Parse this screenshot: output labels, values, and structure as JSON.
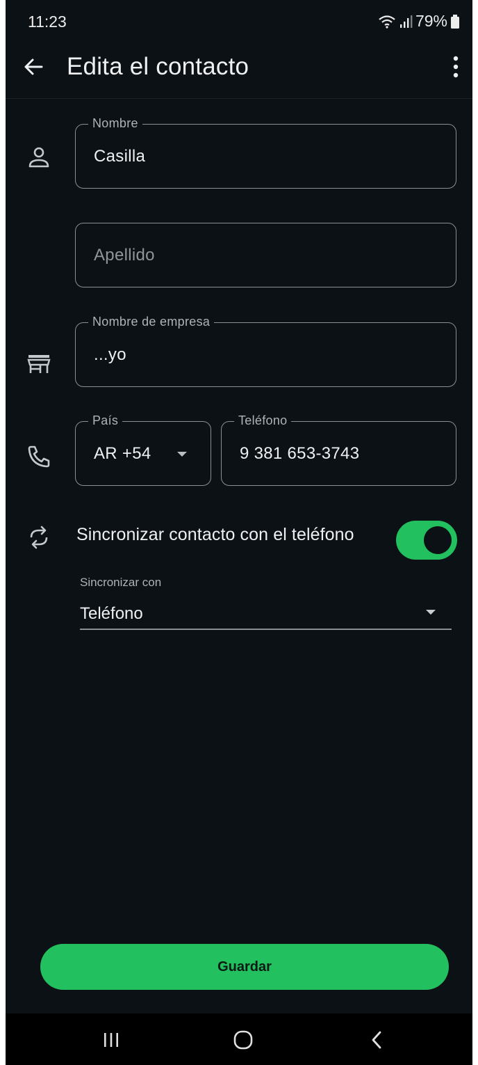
{
  "status_bar": {
    "time": "11:23",
    "battery": "79%"
  },
  "app_bar": {
    "title": "Edita el contacto"
  },
  "form": {
    "first_name": {
      "label": "Nombre",
      "value": "Casilla"
    },
    "last_name": {
      "placeholder": "Apellido"
    },
    "company": {
      "label": "Nombre de empresa",
      "value": "...yo"
    },
    "country": {
      "label": "País",
      "value": "AR +54"
    },
    "phone": {
      "label": "Teléfono",
      "value": "9 381 653-3743"
    },
    "sync": {
      "label": "Sincronizar contacto con el teléfono",
      "enabled": true
    },
    "sync_with": {
      "label": "Sincronizar con",
      "value": "Teléfono"
    }
  },
  "save_button": {
    "label": "Guardar"
  },
  "icons": {
    "back": "arrow-back-icon",
    "more": "more-vert-icon",
    "person": "person-icon",
    "store": "store-icon",
    "phone": "phone-icon",
    "sync": "sync-icon"
  },
  "colors": {
    "accent": "#22c05f",
    "background": "#0c1115"
  }
}
